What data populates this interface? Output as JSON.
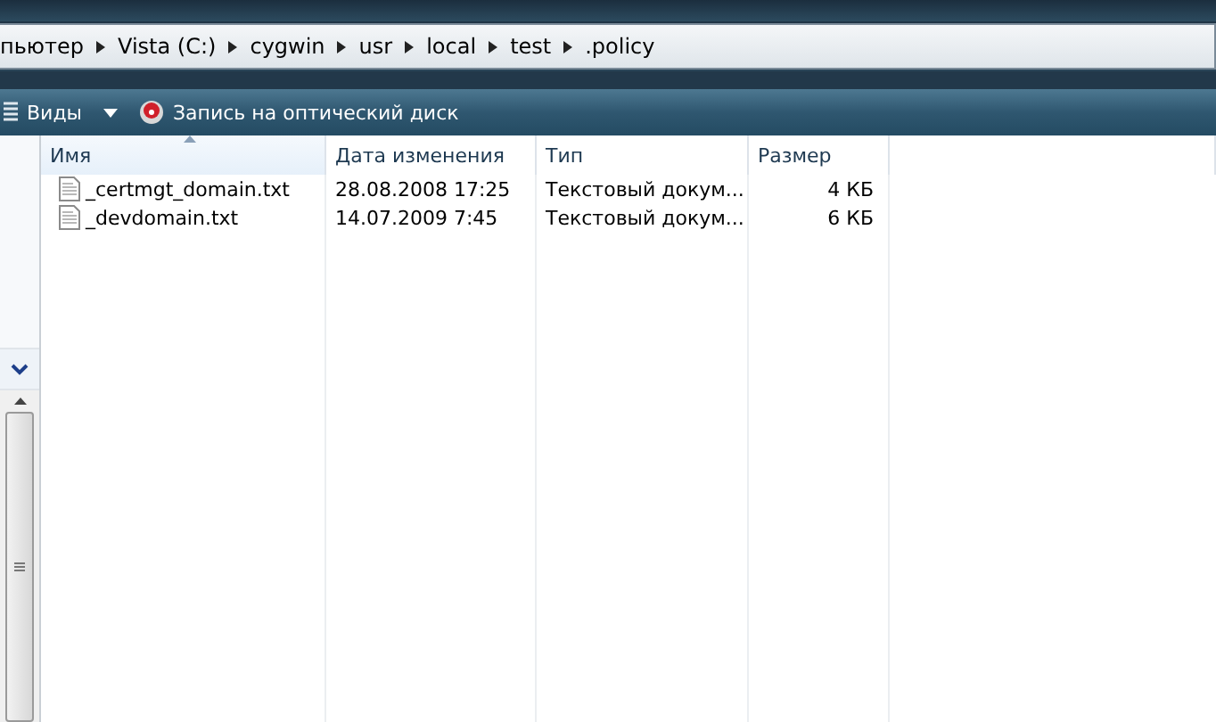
{
  "breadcrumb": [
    "пьютер",
    "Vista (C:)",
    "cygwin",
    "usr",
    "local",
    "test",
    ".policy"
  ],
  "toolbar": [
    {
      "kind": "views",
      "label": "Виды"
    },
    {
      "kind": "burn",
      "label": "Запись на оптический диск"
    }
  ],
  "columns": [
    {
      "label": "Имя",
      "sorted": true
    },
    {
      "label": "Дата изменения",
      "sorted": false
    },
    {
      "label": "Тип",
      "sorted": false
    },
    {
      "label": "Размер",
      "sorted": false
    }
  ],
  "rows": [
    {
      "name": "_certmgt_domain.txt",
      "date": "28.08.2008 17:25",
      "type": "Текстовый докум...",
      "size": "4 КБ"
    },
    {
      "name": "_devdomain.txt",
      "date": "14.07.2009 7:45",
      "type": "Текстовый докум...",
      "size": "6 КБ"
    }
  ]
}
